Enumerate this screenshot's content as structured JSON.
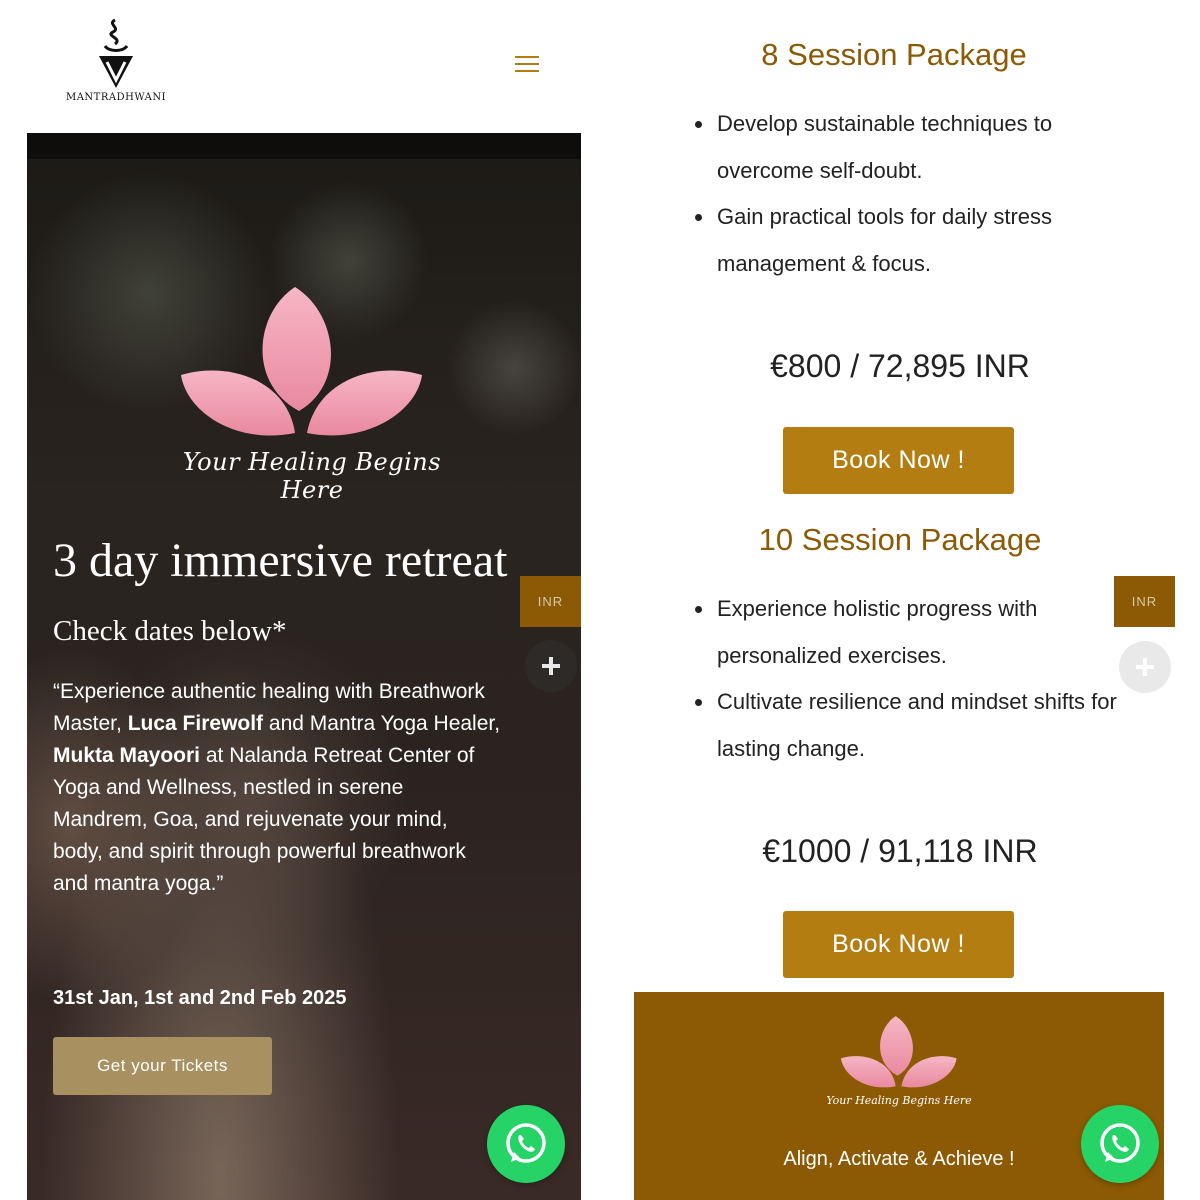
{
  "brand": {
    "name": "MANTRADHWANI",
    "accent_color": "#b47d12",
    "dark_accent": "#8c5a04"
  },
  "nav": {
    "menu_icon": "hamburger-icon"
  },
  "hero": {
    "art_tagline": "Your Healing Begins Here",
    "title": "3 day immersive retreat",
    "subtitle": "Check dates below*",
    "quote_part1": "“Experience authentic healing with Breathwork Master, ",
    "teacher1": "Luca Firewolf",
    "quote_part2": " and Mantra Yoga Healer, ",
    "teacher2": "Mukta Mayoori",
    "quote_part3": " at Nalanda Retreat Center of Yoga and Wellness, nestled in serene Mandrem, Goa, and rejuvenate your mind, body, and spirit through powerful breathwork and mantra yoga.”",
    "dates": "31st Jan, 1st and 2nd Feb 2025",
    "cta": "Get your Tickets"
  },
  "currency_tab": "INR",
  "packages": [
    {
      "title": "8 Session Package",
      "bullets": [
        "Develop sustainable techniques to overcome self-doubt.",
        "Gain practical tools for daily stress management & focus."
      ],
      "price": "€800 / 72,895 INR",
      "cta": "Book Now !"
    },
    {
      "title": "10 Session Package",
      "bullets": [
        "Experience holistic progress with personalized exercises.",
        "Cultivate resilience and mindset shifts for lasting change."
      ],
      "price": "€1000 / 91,118 INR",
      "cta": "Book Now !"
    }
  ],
  "footer": {
    "art_tagline": "Your Healing Begins Here",
    "slogan": "Align, Activate & Achieve !"
  }
}
